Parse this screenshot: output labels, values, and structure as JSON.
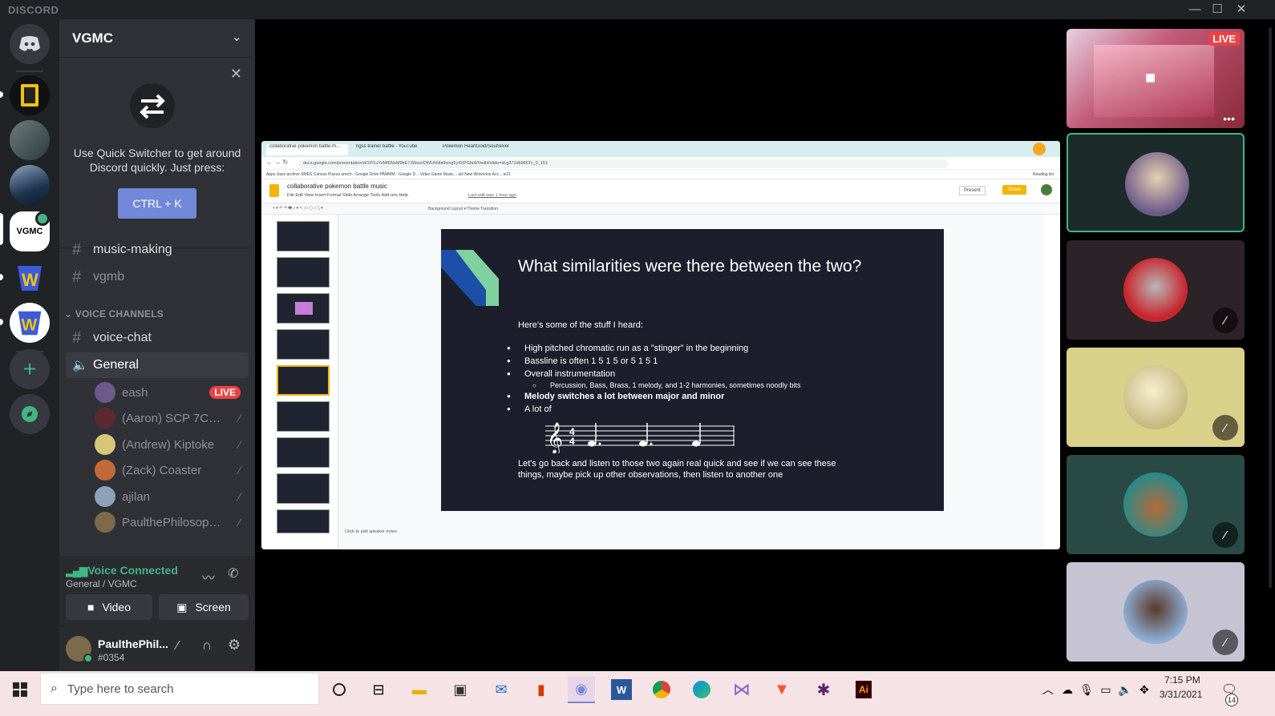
{
  "titlebar": {
    "brand": "DISCORD"
  },
  "server": {
    "name": "VGMC"
  },
  "quick_switcher": {
    "line1": "Use Quick Switcher to get around",
    "line2": "Discord quickly. Just press:",
    "button": "CTRL + K"
  },
  "channels": {
    "text": [
      {
        "name": "music-making"
      },
      {
        "name": "vgmb"
      }
    ],
    "voice_category": "VOICE CHANNELS",
    "voice": [
      {
        "name": "voice-chat"
      },
      {
        "name": "General"
      }
    ]
  },
  "voice_users": [
    {
      "name": "eash",
      "badge": "LIVE"
    },
    {
      "name": "(Aaron) SCP 7C: De..."
    },
    {
      "name": "(Andrew) Kiptoke"
    },
    {
      "name": "(Zack) Coaster"
    },
    {
      "name": "ajilan"
    },
    {
      "name": "PaulthePhilosophy..."
    }
  ],
  "voice_panel": {
    "status": "Voice Connected",
    "location": "General / VGMC",
    "video_label": "Video",
    "screen_label": "Screen"
  },
  "user_panel": {
    "name": "PaulthePhil...",
    "tag": "#0354"
  },
  "tiles": {
    "live_badge": "LIVE"
  },
  "share": {
    "tabs": [
      "collaborative pokemon battle m...",
      "hgss trainer battle - YouTube",
      "Pokemon HeartGold/SoulSilver"
    ],
    "url": "docs.google.com/presentation/d/1PCuYsMf6NoM9bE7JWwzrDWUhNbt9wxg5y4XPGfaWVedit#slide=id.g371db9867c_0_151",
    "bookmarks": "Apps   class archive   SMES   Canvas   Piazza   umich - Google Drive   PAMMM - Google D...   Video Game Music...   util   New Wolverine Acc...   w21",
    "reading_list": "Reading list",
    "doc_title": "collaborative pokemon battle music",
    "doc_menu": "File   Edit   View   Insert   Format   Slide   Arrange   Tools   Add-ons   Help",
    "last_edit": "Last edit was 1 hour ago",
    "present": "Present",
    "share_btn": "Share",
    "tools_text": "Background     Layout ▾     Theme     Transition",
    "speaker_notes": "Click to add speaker notes",
    "slide": {
      "title": "What similarities were there between the two?",
      "intro": "Here's some of the stuff I heard:",
      "bullets": [
        "High pitched chromatic run as a \"stinger\" in the beginning",
        "Bassline is often 1 5 1 5 or 5 1 5 1",
        "Overall instrumentation"
      ],
      "subbullet": "Percussion, Bass, Brass, 1 melody, and 1-2 harmonies, sometimes noodly bits",
      "bullets2": [
        "Melody switches a lot between major and minor",
        "A lot of"
      ],
      "footer_line1": "Let's go back and listen to those two again real quick and see if we can see these",
      "footer_line2": "things, maybe pick up other observations, then listen to another one"
    }
  },
  "taskbar": {
    "search_placeholder": "Type here to search",
    "time": "7:15 PM",
    "date": "3/31/2021",
    "notif_count": "14"
  },
  "colors": {
    "accent": "#7289da",
    "voice_green": "#43b581",
    "live_red": "#ed4245",
    "sidebar": "#2f3136",
    "guilds": "#202225"
  }
}
